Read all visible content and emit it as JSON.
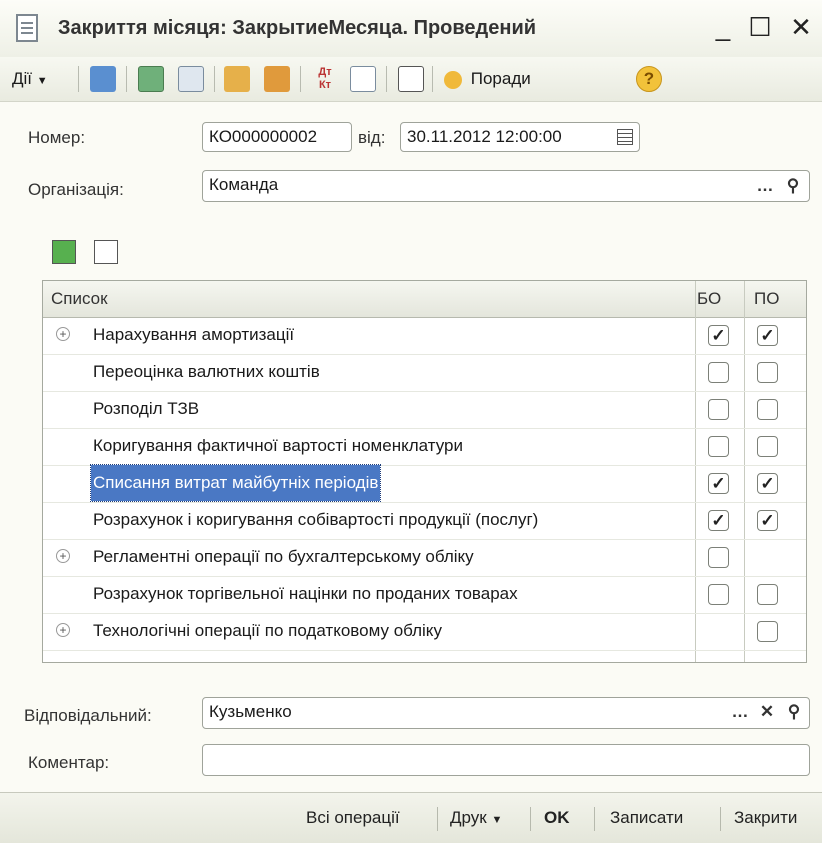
{
  "window": {
    "title": "Закриття місяця: ЗакрытиеМесяца. Проведений",
    "minimize": "_",
    "maximize": "☐",
    "close": "✕"
  },
  "toolbar": {
    "actions_label": "Дії",
    "tips_label": "Поради",
    "help_label": "?"
  },
  "form": {
    "number_label": "Номер:",
    "number_value": "КО000000002",
    "date_label": "від:",
    "date_value": "30.11.2012 12:00:00",
    "org_label": "Організація:",
    "org_value": "Команда",
    "responsible_label": "Відповідальний:",
    "responsible_value": "Кузьменко",
    "comment_label": "Коментар:",
    "comment_value": ""
  },
  "table": {
    "headers": {
      "list": "Список",
      "bo": "БО",
      "po": "ПО"
    },
    "rows": [
      {
        "label": "Нарахування амортизації",
        "expand": true,
        "bo": "checked",
        "po": "checked"
      },
      {
        "label": "Переоцінка валютних коштів",
        "expand": false,
        "bo": "unchecked",
        "po": "unchecked"
      },
      {
        "label": "Розподіл ТЗВ",
        "expand": false,
        "bo": "unchecked",
        "po": "unchecked"
      },
      {
        "label": "Коригування фактичної вартості номенклатури",
        "expand": false,
        "bo": "unchecked",
        "po": "unchecked"
      },
      {
        "label": "Списання витрат майбутніх періодів",
        "expand": false,
        "bo": "checked",
        "po": "checked",
        "selected": true
      },
      {
        "label": "Розрахунок і коригування собівартості продукції (послуг)",
        "expand": false,
        "bo": "checked",
        "po": "checked"
      },
      {
        "label": "Регламентні операції по бухгалтерському обліку",
        "expand": true,
        "bo": "unchecked",
        "po": "none"
      },
      {
        "label": "Розрахунок торгівельної націнки по проданих товарах",
        "expand": false,
        "bo": "unchecked",
        "po": "unchecked"
      },
      {
        "label": "Технологічні операції по податковому обліку",
        "expand": true,
        "bo": "none",
        "po": "unchecked"
      }
    ]
  },
  "bottom": {
    "all_ops": "Всі операції",
    "print": "Друк",
    "ok": "OK",
    "save": "Записати",
    "close": "Закрити"
  },
  "colors": {
    "selection": "#4a78c4",
    "background": "#fbfbf5"
  }
}
